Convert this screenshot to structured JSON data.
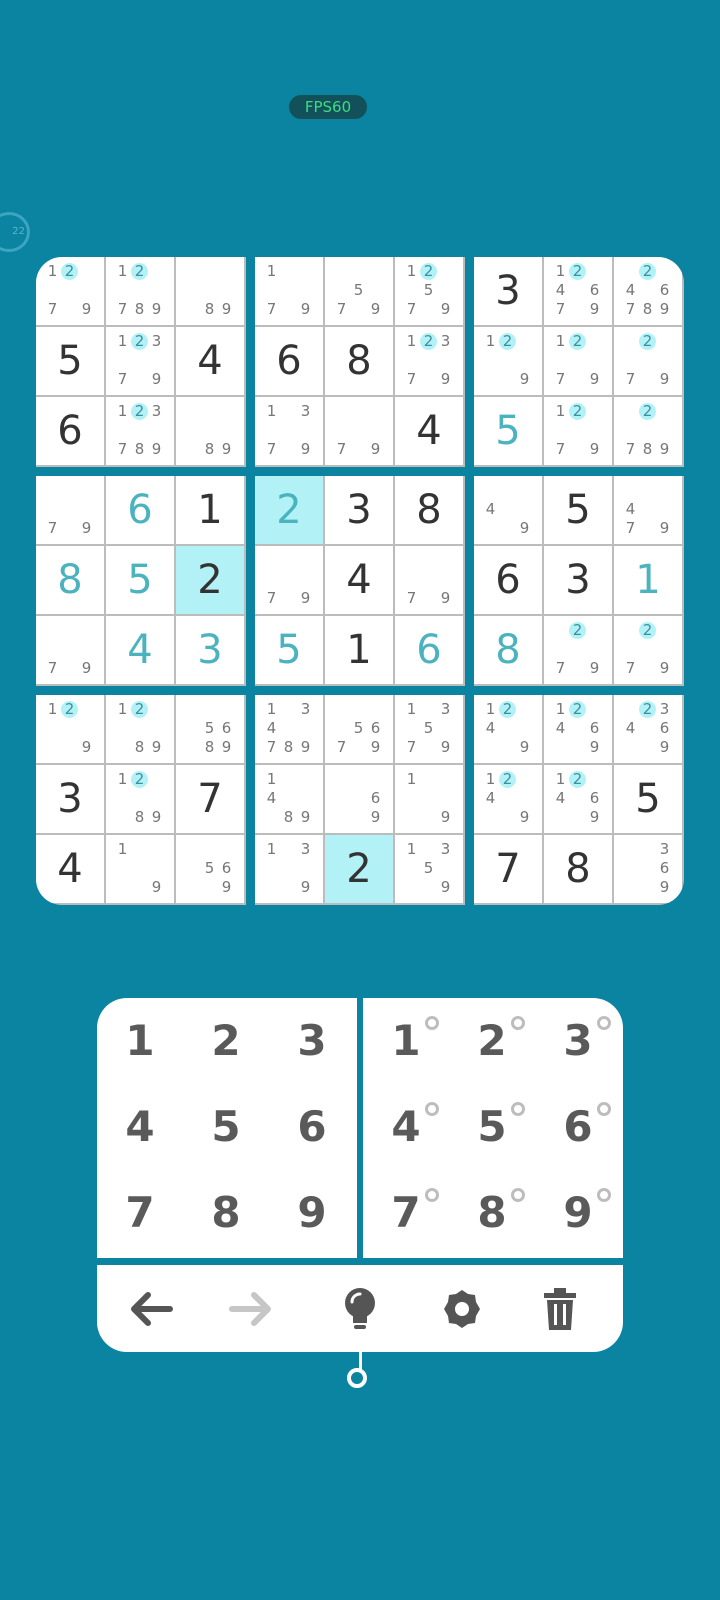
{
  "status": {
    "fps_label": "FPS60",
    "timer_text": "22"
  },
  "grid": [
    [
      {
        "n": "12 79",
        "h": 2
      },
      {
        "n": "12 789",
        "h": 2
      },
      {
        "n": "89"
      },
      {
        "n": "1 79"
      },
      {
        "n": "5 79"
      },
      {
        "n": "12 5 79",
        "h": 2
      },
      {
        "v": "3",
        "g": 1
      },
      {
        "n": "12 46 79",
        "h": 2
      },
      {
        "n": "2 46 789",
        "h": 2
      }
    ],
    [
      {
        "v": "5",
        "g": 1
      },
      {
        "n": "123 79",
        "h": 2
      },
      {
        "v": "4",
        "g": 1
      },
      {
        "v": "6",
        "g": 1
      },
      {
        "v": "8",
        "g": 1
      },
      {
        "n": "123 79",
        "h": 2
      },
      {
        "n": "12 9",
        "h": 2
      },
      {
        "n": "12 79",
        "h": 2
      },
      {
        "n": "2 79",
        "h": 2
      }
    ],
    [
      {
        "v": "6",
        "g": 1
      },
      {
        "n": "123 789",
        "h": 2
      },
      {
        "n": "89"
      },
      {
        "n": "13 79"
      },
      {
        "n": "79"
      },
      {
        "v": "4",
        "g": 1
      },
      {
        "v": "5",
        "g": 0
      },
      {
        "n": "12 79",
        "h": 2
      },
      {
        "n": "2 789",
        "h": 2
      }
    ],
    [
      {
        "n": "79"
      },
      {
        "v": "6",
        "g": 0
      },
      {
        "v": "1",
        "g": 1
      },
      {
        "v": "2",
        "g": 0,
        "s": 1
      },
      {
        "v": "3",
        "g": 1
      },
      {
        "v": "8",
        "g": 1
      },
      {
        "n": "4 9"
      },
      {
        "v": "5",
        "g": 1
      },
      {
        "n": "4 79"
      }
    ],
    [
      {
        "v": "8",
        "g": 0
      },
      {
        "v": "5",
        "g": 0
      },
      {
        "v": "2",
        "g": 1,
        "s": 1
      },
      {
        "n": "79"
      },
      {
        "v": "4",
        "g": 1
      },
      {
        "n": "79"
      },
      {
        "v": "6",
        "g": 1
      },
      {
        "v": "3",
        "g": 1
      },
      {
        "v": "1",
        "g": 0
      }
    ],
    [
      {
        "n": "79"
      },
      {
        "v": "4",
        "g": 0
      },
      {
        "v": "3",
        "g": 0
      },
      {
        "v": "5",
        "g": 0
      },
      {
        "v": "1",
        "g": 1
      },
      {
        "v": "6",
        "g": 0
      },
      {
        "v": "8",
        "g": 0
      },
      {
        "n": "2 79",
        "h": 2
      },
      {
        "n": "2 79",
        "h": 2
      }
    ],
    [
      {
        "n": "12 9",
        "h": 2
      },
      {
        "n": "12 89",
        "h": 2
      },
      {
        "n": "56 89"
      },
      {
        "n": "13 4 789"
      },
      {
        "n": "56 79"
      },
      {
        "n": "13 5 79"
      },
      {
        "n": "12 4 9",
        "h": 2
      },
      {
        "n": "12 46 9",
        "h": 2
      },
      {
        "n": "23 46 9",
        "h": 2
      }
    ],
    [
      {
        "v": "3",
        "g": 1
      },
      {
        "n": "12 89",
        "h": 2
      },
      {
        "v": "7",
        "g": 1
      },
      {
        "n": "1 4 89"
      },
      {
        "n": "6 9"
      },
      {
        "n": "1 9"
      },
      {
        "n": "12 4 9",
        "h": 2
      },
      {
        "n": "12 46 9",
        "h": 2
      },
      {
        "v": "5",
        "g": 1
      }
    ],
    [
      {
        "v": "4",
        "g": 1
      },
      {
        "n": "1 9"
      },
      {
        "n": "56 9"
      },
      {
        "n": "13 9"
      },
      {
        "v": "2",
        "g": 1,
        "s": 1
      },
      {
        "n": "13 5 9"
      },
      {
        "v": "7",
        "g": 1
      },
      {
        "v": "8",
        "g": 1
      },
      {
        "n": "3 6 9"
      }
    ]
  ],
  "pad": {
    "value_keys": [
      "1",
      "2",
      "3",
      "4",
      "5",
      "6",
      "7",
      "8",
      "9"
    ],
    "note_keys": [
      "1",
      "2",
      "3",
      "4",
      "5",
      "6",
      "7",
      "8",
      "9"
    ]
  },
  "toolbar": [
    {
      "name": "undo-button",
      "icon": "arrow-left-icon"
    },
    {
      "name": "redo-button",
      "icon": "arrow-right-icon"
    },
    {
      "name": "hint-button",
      "icon": "lightbulb-icon"
    },
    {
      "name": "settings-button",
      "icon": "gear-icon"
    },
    {
      "name": "delete-button",
      "icon": "trash-icon"
    }
  ],
  "colors": {
    "background": "#0a84a0",
    "given_digit": "#333333",
    "user_digit": "#4bb3bd",
    "highlight": "#b2f2f6",
    "note_digit": "#777777"
  }
}
